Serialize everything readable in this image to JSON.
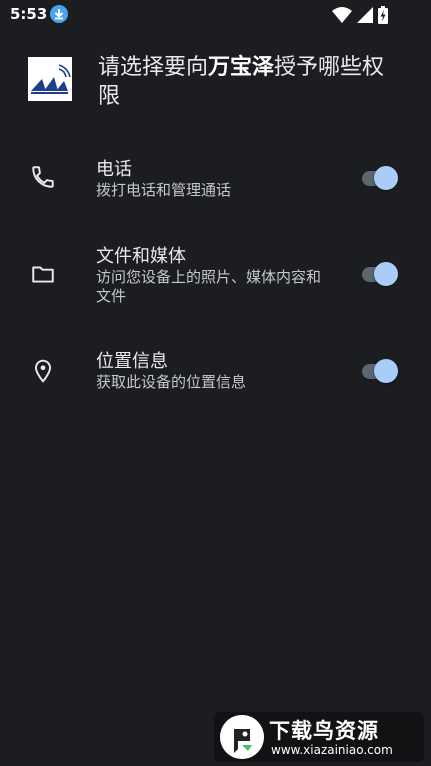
{
  "status_bar": {
    "time": "5:53",
    "icons": [
      "download-icon",
      "wifi-icon",
      "signal-icon",
      "battery-icon"
    ]
  },
  "header": {
    "title_prefix": "请选择要向",
    "app_name": "万宝泽",
    "title_suffix": "授予哪些权限"
  },
  "permissions": [
    {
      "icon": "phone-icon",
      "title": "电话",
      "description": "拨打电话和管理通话",
      "enabled": true
    },
    {
      "icon": "folder-icon",
      "title": "文件和媒体",
      "description": "访问您设备上的照片、媒体内容和文件",
      "enabled": true
    },
    {
      "icon": "location-icon",
      "title": "位置信息",
      "description": "获取此设备的位置信息",
      "enabled": true
    }
  ],
  "watermark": {
    "title": "下载鸟资源",
    "url": "www.xiazainiao.com"
  },
  "colors": {
    "background": "#1b1d20",
    "toggle_thumb": "#a9cdf7",
    "toggle_track": "#5b6670"
  }
}
